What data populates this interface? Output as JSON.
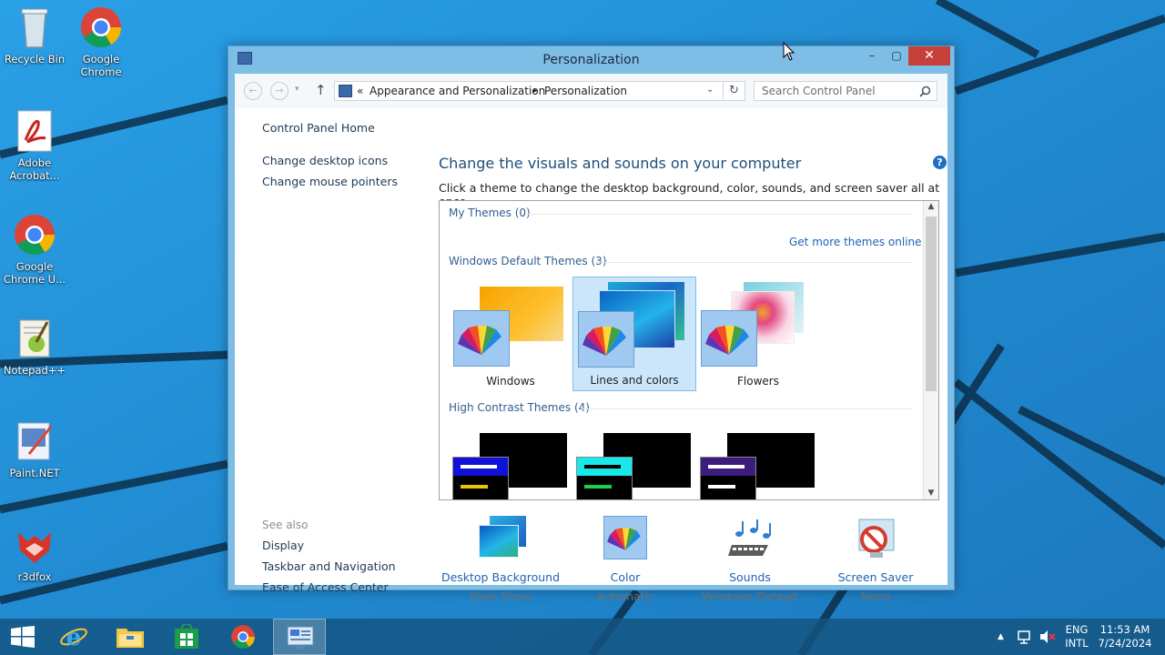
{
  "desktop": {
    "icons": [
      {
        "label": "Recycle Bin",
        "icon": "recycle-bin-icon"
      },
      {
        "label": "Google Chrome",
        "icon": "chrome-icon"
      },
      {
        "label": "Adobe Acrobat...",
        "icon": "acrobat-icon"
      },
      {
        "label": "Google Chrome U...",
        "icon": "chrome-icon"
      },
      {
        "label": "Notepad++",
        "icon": "notepadpp-icon"
      },
      {
        "label": "Paint.NET",
        "icon": "paintnet-icon"
      },
      {
        "label": "r3dfox",
        "icon": "r3dfox-icon"
      }
    ]
  },
  "window": {
    "title": "Personalization",
    "caption_buttons": {
      "minimize": "–",
      "maximize": "▢",
      "close": "✕"
    },
    "address": {
      "chevron": "«",
      "crumbs": [
        "Appearance and Personalization",
        "Personalization"
      ],
      "separator": "▸"
    },
    "search": {
      "placeholder": "Search Control Panel"
    }
  },
  "left_pane": {
    "links": [
      "Control Panel Home",
      "Change desktop icons",
      "Change mouse pointers"
    ],
    "see_also_heading": "See also",
    "see_also": [
      "Display",
      "Taskbar and Navigation",
      "Ease of Access Center"
    ]
  },
  "main": {
    "title": "Change the visuals and sounds on your computer",
    "description": "Click a theme to change the desktop background, color, sounds, and screen saver all at once.",
    "groups": {
      "my_themes": "My Themes (0)",
      "get_more": "Get more themes online",
      "default_themes": "Windows Default Themes (3)",
      "high_contrast": "High Contrast Themes (4)"
    },
    "themes": [
      {
        "name": "Windows",
        "selected": false
      },
      {
        "name": "Lines and colors",
        "selected": true
      },
      {
        "name": "Flowers",
        "selected": false
      }
    ]
  },
  "settings": [
    {
      "label": "Desktop Background",
      "value": "Slide Show",
      "icon": "desktop-background-icon"
    },
    {
      "label": "Color",
      "value": "Automatic",
      "icon": "color-icon"
    },
    {
      "label": "Sounds",
      "value": "Windows Default",
      "icon": "sounds-icon"
    },
    {
      "label": "Screen Saver",
      "value": "None",
      "icon": "screen-saver-icon"
    }
  ],
  "taskbar": {
    "items": [
      "start-button",
      "internet-explorer",
      "file-explorer",
      "store",
      "chrome",
      "control-panel"
    ],
    "tray": {
      "lang_top": "ENG",
      "lang_bottom": "INTL",
      "time": "11:53 AM",
      "date": "7/24/2024",
      "overflow": "▲"
    }
  },
  "colors": {
    "desktop_bg": "#2a8fd6",
    "titlebar": "#7dbde6",
    "close_button": "#c7403a",
    "link": "#1f63b6",
    "selected_theme": "#cbe6fb"
  }
}
